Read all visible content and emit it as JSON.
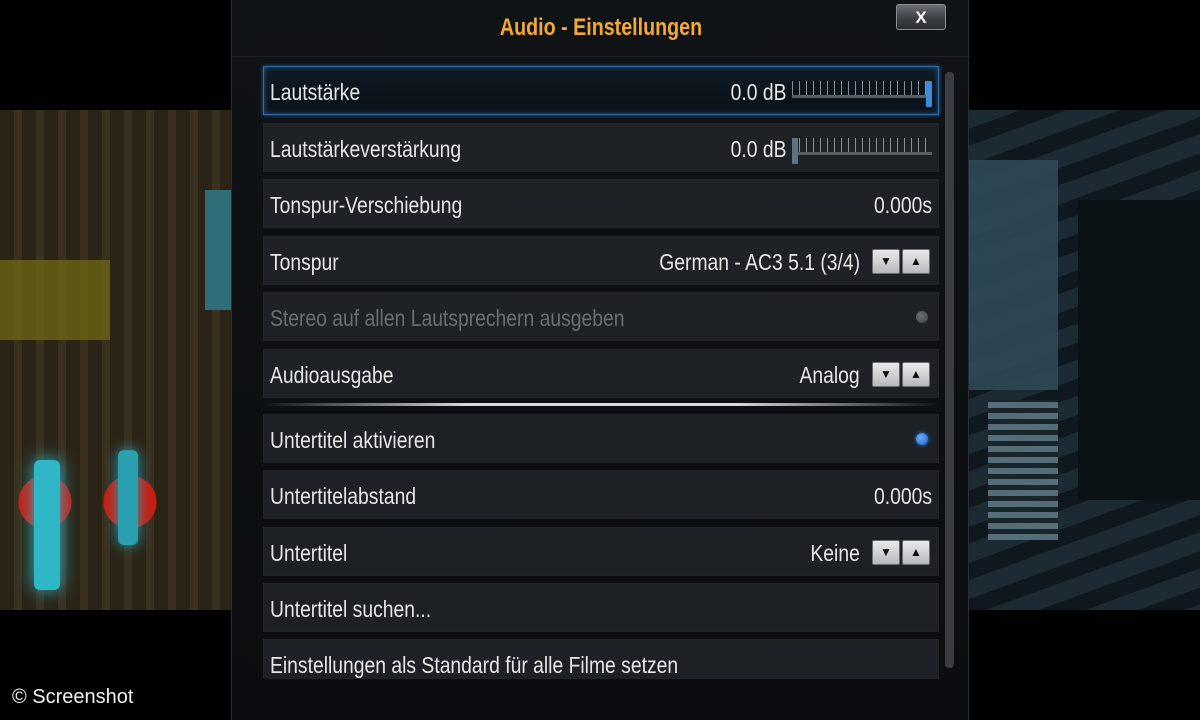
{
  "dialog": {
    "title": "Audio - Einstellungen",
    "close_label": "X"
  },
  "settings": [
    {
      "label": "Lautstärke",
      "value": "0.0 dB",
      "control": "slider",
      "level": 1.0,
      "state": "selected"
    },
    {
      "label": "Lautstärkeverstärkung",
      "value": "0.0 dB",
      "control": "slider",
      "level": 0.0,
      "state": "normal"
    },
    {
      "label": "Tonspur-Verschiebung",
      "value": "0.000s",
      "control": "none",
      "state": "normal"
    },
    {
      "label": "Tonspur",
      "value": "German - AC3 5.1 (3/4)",
      "control": "spinner",
      "state": "normal"
    },
    {
      "label": "Stereo auf allen Lautsprechern ausgeben",
      "value": "",
      "control": "radio",
      "checked": false,
      "state": "disabled"
    },
    {
      "label": "Audioausgabe",
      "value": "Analog",
      "control": "spinner",
      "state": "normal"
    },
    {
      "label": "Untertitel aktivieren",
      "value": "",
      "control": "radio",
      "checked": true,
      "state": "normal"
    },
    {
      "label": "Untertitelabstand",
      "value": "0.000s",
      "control": "none",
      "state": "normal"
    },
    {
      "label": "Untertitel",
      "value": "Keine",
      "control": "spinner",
      "state": "normal"
    },
    {
      "label": "Untertitel suchen...",
      "value": "",
      "control": "none",
      "state": "normal"
    },
    {
      "label": "Einstellungen als Standard für alle Filme setzen",
      "value": "",
      "control": "none",
      "state": "normal"
    }
  ],
  "spinner": {
    "down_glyph": "▼",
    "up_glyph": "▲"
  },
  "credit": "© Screenshot",
  "colors": {
    "title": "#f3a933",
    "accent": "#3a8ed8"
  }
}
